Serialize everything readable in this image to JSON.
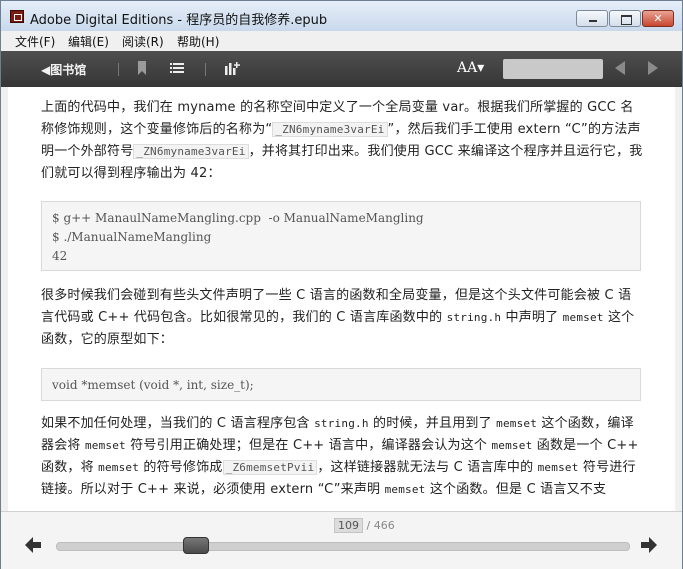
{
  "window": {
    "title": "Adobe Digital Editions - 程序员的自我修养.epub",
    "close_glyph": "✕"
  },
  "menu": [
    "文件(F)",
    "编辑(E)",
    "阅读(R)",
    "帮助(H)"
  ],
  "toolbar": {
    "library_label": "◀图书馆",
    "font_size_label": "AA▾",
    "icons": [
      "bookmark-icon",
      "toc-list-icon",
      "chart-add-icon",
      "prev-page-icon",
      "next-page-icon"
    ]
  },
  "content": {
    "p1": {
      "t1": "上面的代码中，我们在 myname 的名称空间中定义了一个全局变量 var。根据我们所掌握的 GCC 名称修饰规则，这个变量修饰后的名称为“",
      "c1": "_ZN6myname3varEi",
      "t2": "”，然后我们手工使用 extern “C”的方法声明一个外部符号",
      "c2": "_ZN6myname3varEi",
      "t3": "，并将其打印出来。我们使用 GCC 来编译这个程序并且运行它，我们就可以得到程序输出为 42："
    },
    "code1": "$ g++ ManaulNameMangling.cpp  -o ManualNameMangling\n$ ./ManualNameMangling\n42",
    "p2": {
      "t1": "很多时候我们会碰到有些头文件声明了一些 C 语言的函数和全局变量，但是这个头文件可能会被 C 语言代码或 C++ 代码包含。比如很常见的，我们的 C 语言库函数中的 ",
      "m1": "string.h",
      "t2": " 中声明了 ",
      "m2": "memset",
      "t3": " 这个函数，它的原型如下："
    },
    "code2": "void *memset (void *, int, size_t);",
    "p3": {
      "t1": "如果不加任何处理，当我们的 C 语言程序包含 ",
      "m1": "string.h",
      "t2": " 的时候，并且用到了 ",
      "m2": "memset",
      "t3": " 这个函数，编译器会将 ",
      "m3": "memset",
      "t4": " 符号引用正确处理；但是在 C++ 语言中，编译器会认为这个 ",
      "m4": "memset",
      "t5": " 函数是一个 C++ 函数，将 ",
      "m5": "memset",
      "t6": " 的符号修饰成",
      "c1": "_Z6memsetPvii",
      "t7": "，这样链接器就无法与 C 语言库中的 ",
      "m6": "memset",
      "t8": " 符号进行链接。所以对于 C++ 来说，必须使用 extern “C”来声明 ",
      "m7": "memset",
      "t9": " 这个函数。但是 C 语言又不支"
    }
  },
  "pager": {
    "current": "109",
    "total": "/ 466",
    "progress": 0.233
  }
}
